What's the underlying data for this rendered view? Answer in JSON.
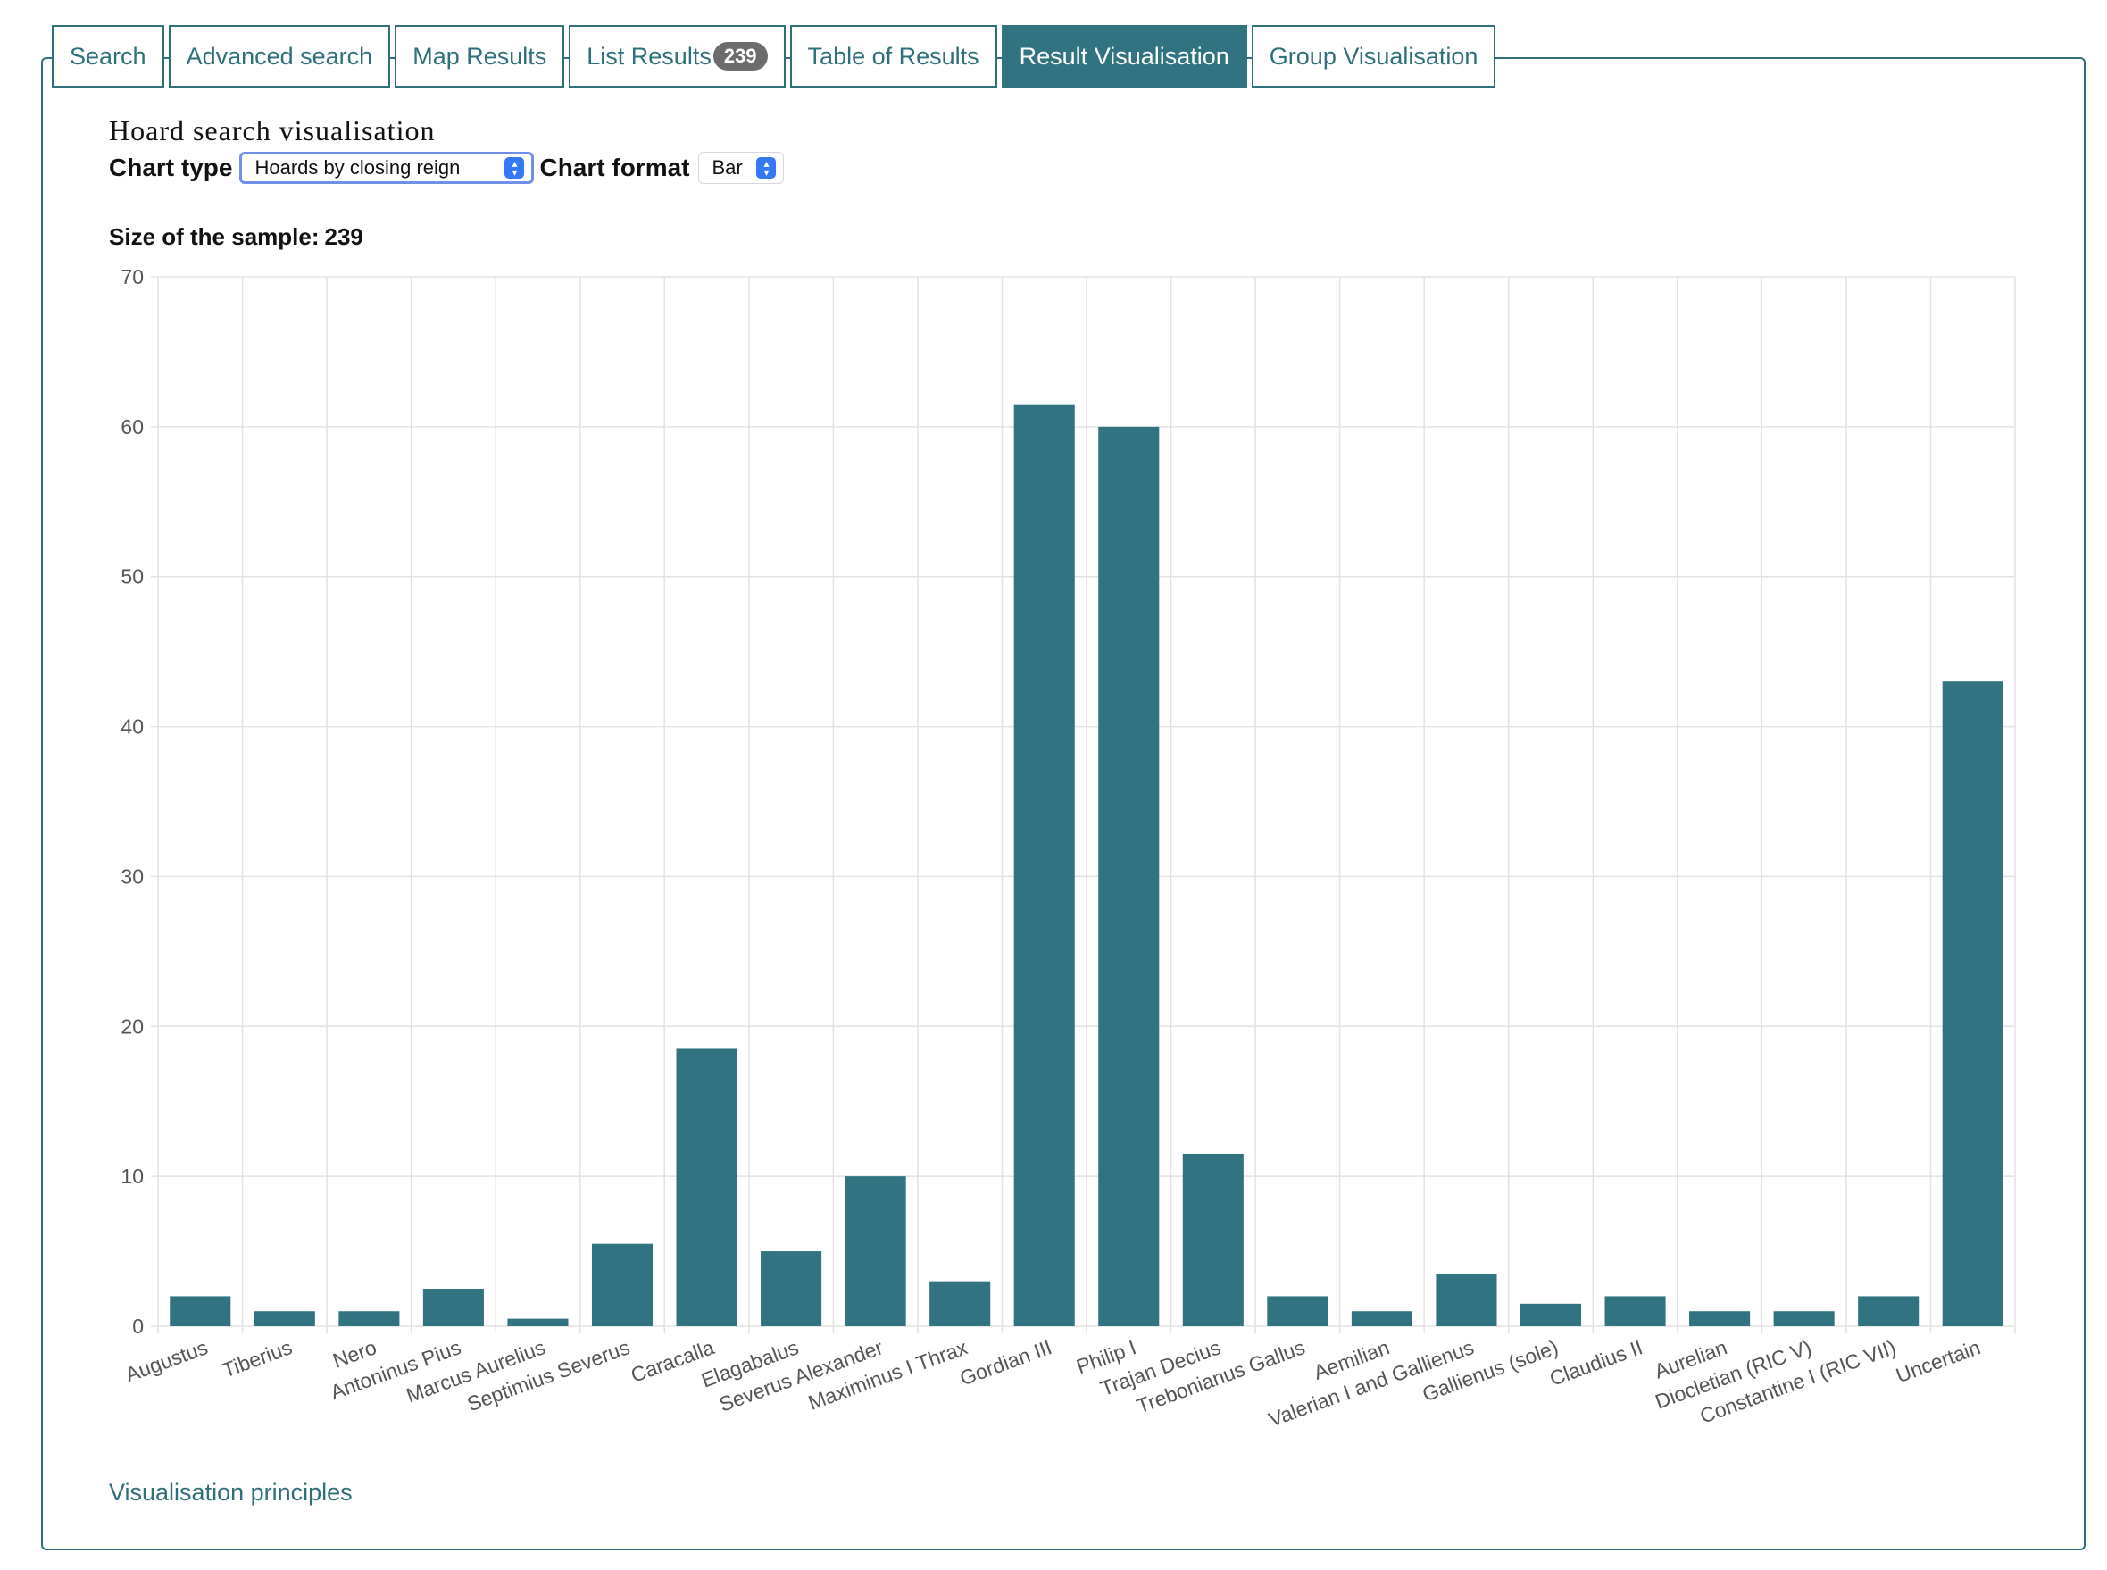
{
  "tabs": [
    {
      "label": "Search",
      "active": false
    },
    {
      "label": "Advanced search",
      "active": false
    },
    {
      "label": "Map Results",
      "active": false
    },
    {
      "label": "List Results",
      "badge": "239",
      "active": false
    },
    {
      "label": "Table of Results",
      "active": false
    },
    {
      "label": "Result Visualisation",
      "active": true
    },
    {
      "label": "Group Visualisation",
      "active": false
    }
  ],
  "page": {
    "title": "Hoard search visualisation",
    "chart_type_label": "Chart type",
    "chart_type_value": "Hoards by closing reign",
    "chart_format_label": "Chart format",
    "chart_format_value": "Bar",
    "sample_label": "Size of the sample:",
    "sample_value": "239",
    "principles_link": "Visualisation principles"
  },
  "colors": {
    "accent": "#317380",
    "bar": "#317380",
    "grid": "#e2e2e2"
  },
  "chart_data": {
    "type": "bar",
    "categories": [
      "Augustus",
      "Tiberius",
      "Nero",
      "Antoninus Pius",
      "Marcus Aurelius",
      "Septimius Severus",
      "Caracalla",
      "Elagabalus",
      "Severus Alexander",
      "Maximinus I Thrax",
      "Gordian III",
      "Philip I",
      "Trajan Decius",
      "Trebonianus Gallus",
      "Aemilian",
      "Valerian I and Gallienus",
      "Gallienus (sole)",
      "Claudius II",
      "Aurelian",
      "Diocletian (RIC V)",
      "Constantine I (RIC VII)",
      "Uncertain"
    ],
    "values": [
      2,
      1,
      1,
      2.5,
      0.5,
      5.5,
      18.5,
      5,
      10,
      3,
      61.5,
      60,
      11.5,
      2,
      1,
      3.5,
      1.5,
      2,
      1,
      1,
      2,
      43
    ],
    "yticks": [
      "0",
      "10",
      "20",
      "30",
      "40",
      "50",
      "60",
      "70"
    ],
    "ylim": [
      0,
      70
    ],
    "grid": true
  }
}
